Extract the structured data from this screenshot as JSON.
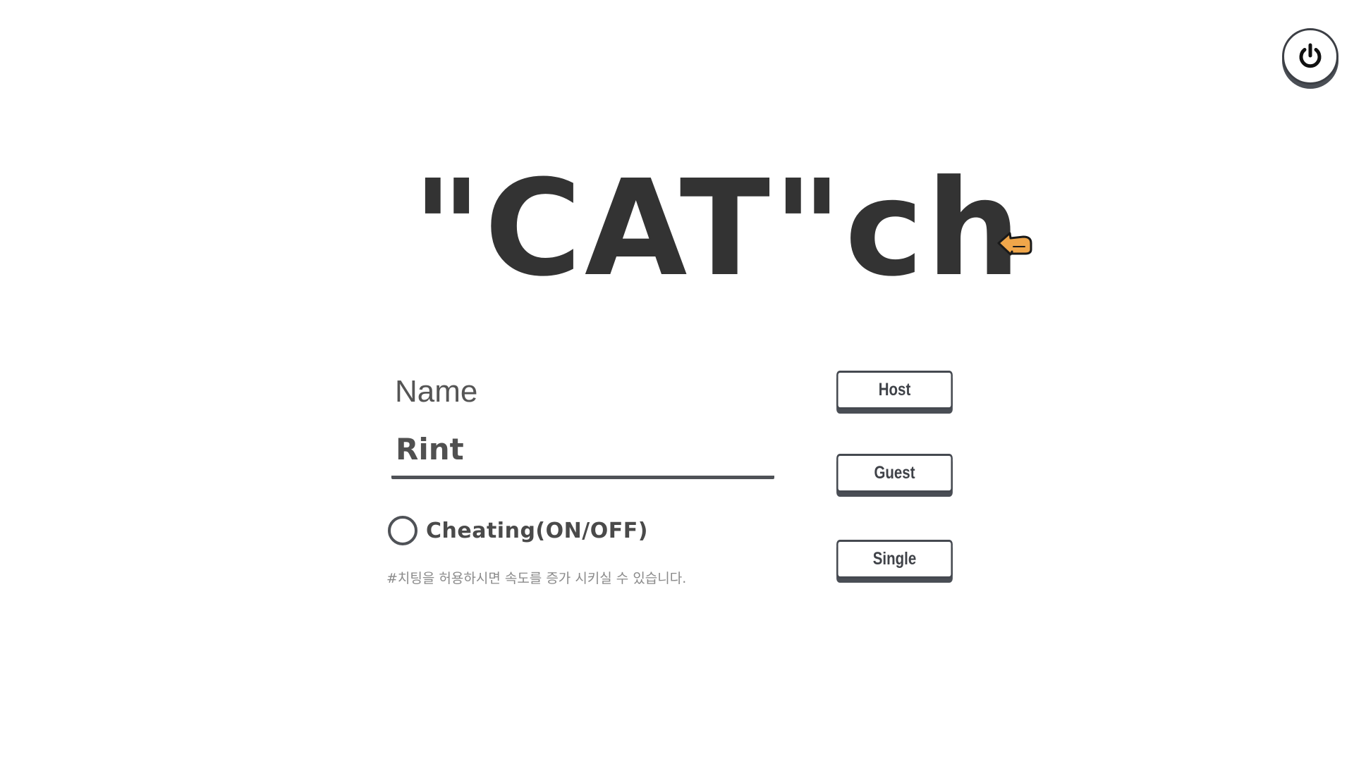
{
  "app": {
    "title": "\"CAT\"ch"
  },
  "icons": {
    "power": "power-icon",
    "cursor": "pointing-hand-cursor-icon"
  },
  "colors": {
    "text": "#333333",
    "accent_dark": "#4a4e55",
    "cursor_fill": "#f0a64a"
  },
  "form": {
    "name_label": "Name",
    "name_value": "Rint",
    "cheating_label": "Cheating(ON/OFF)",
    "cheating_on": false,
    "cheating_note": "#치팅을 허용하시면 속도를 증가 시키실 수 있습니다."
  },
  "buttons": {
    "host": "Host",
    "guest": "Guest",
    "single": "Single"
  }
}
